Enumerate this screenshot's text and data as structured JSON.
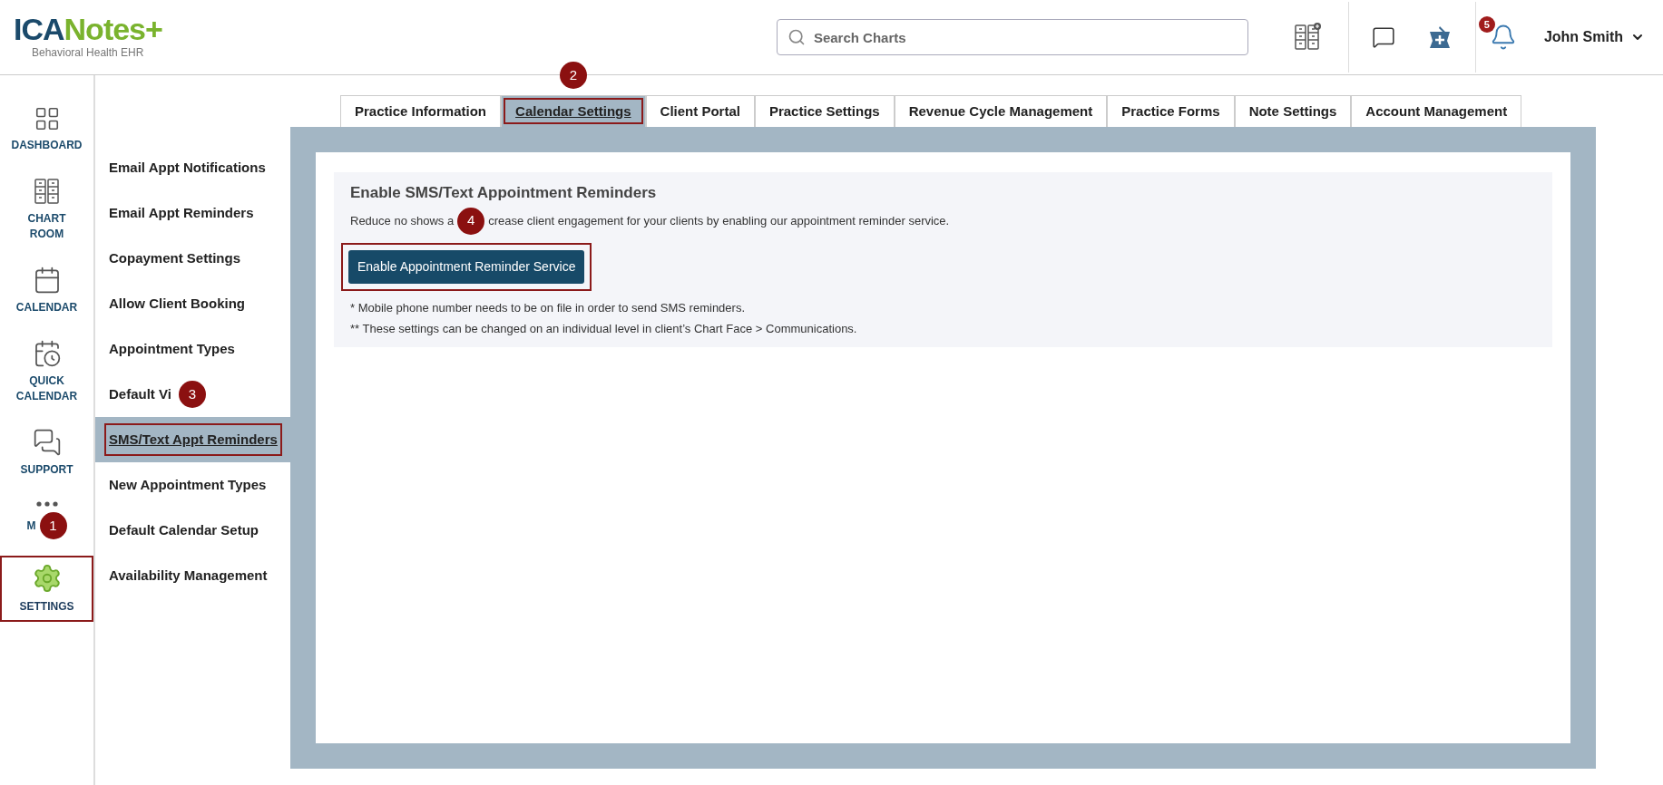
{
  "logo": {
    "wordmark_dark": "ICA",
    "wordmark_green": "Notes+",
    "tagline": "Behavioral Health EHR"
  },
  "search": {
    "placeholder": "Search Charts"
  },
  "notifications": {
    "count": "5"
  },
  "user": {
    "name": "John Smith"
  },
  "nav": [
    {
      "kind": "dashboard",
      "label": "DASHBOARD",
      "selected": false,
      "highlighted": false
    },
    {
      "kind": "chartroom",
      "label": "CHART ROOM",
      "selected": false,
      "highlighted": false
    },
    {
      "kind": "calendar",
      "label": "CALENDAR",
      "selected": false,
      "highlighted": false
    },
    {
      "kind": "quickcalendar",
      "label": "QUICK CALENDAR",
      "selected": false,
      "highlighted": false
    },
    {
      "kind": "support",
      "label": "SUPPORT",
      "selected": false,
      "highlighted": false
    },
    {
      "kind": "more",
      "label": "M",
      "callout": "1",
      "selected": false,
      "highlighted": false
    },
    {
      "kind": "settings",
      "label": "SETTINGS",
      "selected": true,
      "highlighted": true
    }
  ],
  "tabs": [
    {
      "label": "Practice Information",
      "selected": false,
      "highlighted": false
    },
    {
      "label": "Calendar Settings",
      "selected": true,
      "highlighted": true,
      "callout": "2"
    },
    {
      "label": "Client Portal",
      "selected": false,
      "highlighted": false
    },
    {
      "label": "Practice Settings",
      "selected": false,
      "highlighted": false
    },
    {
      "label": "Revenue Cycle Management",
      "selected": false,
      "highlighted": false
    },
    {
      "label": "Practice Forms",
      "selected": false,
      "highlighted": false
    },
    {
      "label": "Note Settings",
      "selected": false,
      "highlighted": false
    },
    {
      "label": "Account Management",
      "selected": false,
      "highlighted": false
    }
  ],
  "subnav": [
    {
      "label": "Email Appt Notifications",
      "selected": false,
      "highlighted": false
    },
    {
      "label": "Email Appt Reminders",
      "selected": false,
      "highlighted": false
    },
    {
      "label": "Copayment Settings",
      "selected": false,
      "highlighted": false
    },
    {
      "label": "Allow Client Booking",
      "selected": false,
      "highlighted": false
    },
    {
      "label": "Appointment Types",
      "selected": false,
      "highlighted": false
    },
    {
      "label": "Default Vi",
      "callout": "3",
      "selected": false,
      "highlighted": false
    },
    {
      "label": "SMS/Text Appt Reminders",
      "selected": true,
      "highlighted": true
    },
    {
      "label": "New Appointment Types",
      "selected": false,
      "highlighted": false
    },
    {
      "label": "Default Calendar Setup",
      "selected": false,
      "highlighted": false
    },
    {
      "label": "Availability Management",
      "selected": false,
      "highlighted": false
    }
  ],
  "section": {
    "title": "Enable SMS/Text Appointment Reminders",
    "description_before": "Reduce no shows a",
    "callout": "4",
    "description_after": "crease client engagement for your clients by enabling our appointment reminder service.",
    "button": {
      "label": "Enable Appointment Reminder Service",
      "highlighted": true
    },
    "notes": [
      "* Mobile phone number needs to be on file in order to send SMS reminders.",
      "** These settings can be changed on an individual level in client’s Chart Face > Communications."
    ]
  }
}
